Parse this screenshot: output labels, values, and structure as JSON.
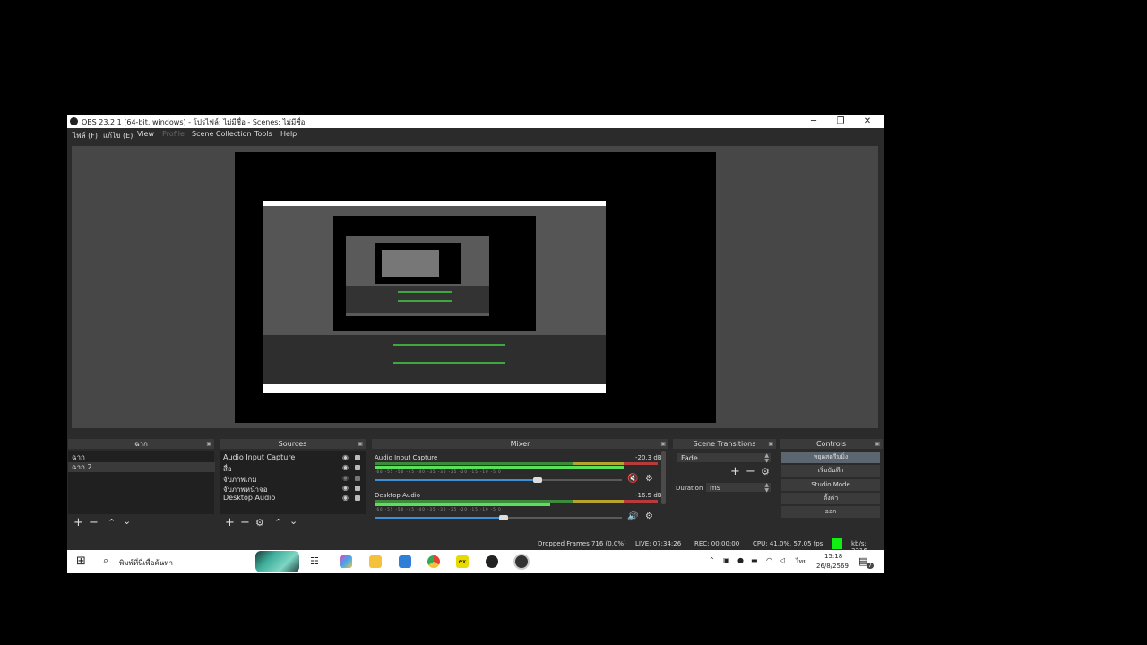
{
  "window": {
    "title": "OBS 23.2.1 (64-bit, windows) - โปรไฟล์: ไม่มีชื่อ - Scenes: ไม่มีชื่อ",
    "minimize": "─",
    "maximize": "❐",
    "close": "✕"
  },
  "menu": [
    "ไฟล์ (F)",
    "แก้ไข (E)",
    "View",
    "Profile",
    "Scene Collection",
    "Tools",
    "Help"
  ],
  "docks": {
    "scenes": {
      "title": "ฉาก",
      "items": [
        "ฉาก",
        "ฉาก 2"
      ],
      "selected": 1
    },
    "sources": {
      "title": "Sources",
      "items": [
        "Audio Input Capture",
        "สื่อ",
        "จับภาพเกม",
        "จับภาพหน้าจอ",
        "Desktop Audio"
      ]
    },
    "mixer": {
      "title": "Mixer",
      "channels": [
        {
          "name": "Audio Input Capture",
          "db": "-20.3 dB",
          "level": 0.88,
          "volume": 0.66,
          "muted": true
        },
        {
          "name": "Desktop Audio",
          "db": "-16.5 dB",
          "level": 0.62,
          "volume": 0.52,
          "muted": false
        }
      ],
      "ticks": "-60 -55 -50 -45 -40 -35 -30 -25 -20 -15 -10 -5 0"
    },
    "transitions": {
      "title": "Scene Transitions",
      "selected": "Fade",
      "duration_label": "Duration",
      "duration_value": "ms"
    },
    "controls": {
      "title": "Controls",
      "buttons": [
        "หยุดสตรีมมิ่ง",
        "เริ่มบันทึก",
        "Studio Mode",
        "ตั้งค่า",
        "ออก"
      ]
    }
  },
  "status": {
    "dropped": "Dropped Frames 716 (0.0%)",
    "live": "LIVE: 07:34:26",
    "rec": "REC: 00:00:00",
    "cpu": "CPU: 41.0%, 57.05 fps",
    "kbps": "kb/s: 3216"
  },
  "taskbar": {
    "search_placeholder": "พิมพ์ที่นี่เพื่อค้นหา",
    "time": "15:18",
    "date": "26/8/2569",
    "lang": "ไทย",
    "notif_count": "7"
  },
  "colors": {
    "accent_green": "#11ee11",
    "meter_green": "#3d8a3d",
    "slider_blue": "#3d8fd6"
  }
}
